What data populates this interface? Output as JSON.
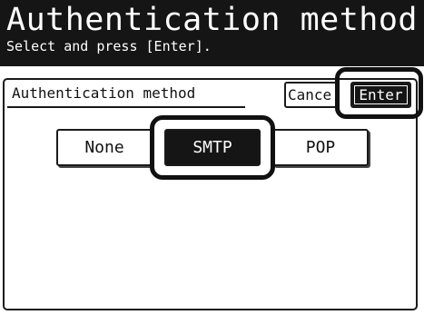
{
  "header": {
    "title": "Authentication method",
    "subtitle": "Select and press [Enter]."
  },
  "panel": {
    "label": "Authentication method",
    "cancel_label": "Cance",
    "enter_label": "Enter",
    "options": [
      {
        "label": "None",
        "selected": false
      },
      {
        "label": "SMTP",
        "selected": true
      },
      {
        "label": "POP",
        "selected": false
      }
    ]
  },
  "colors": {
    "dark": "#151515",
    "light": "#ffffff"
  }
}
